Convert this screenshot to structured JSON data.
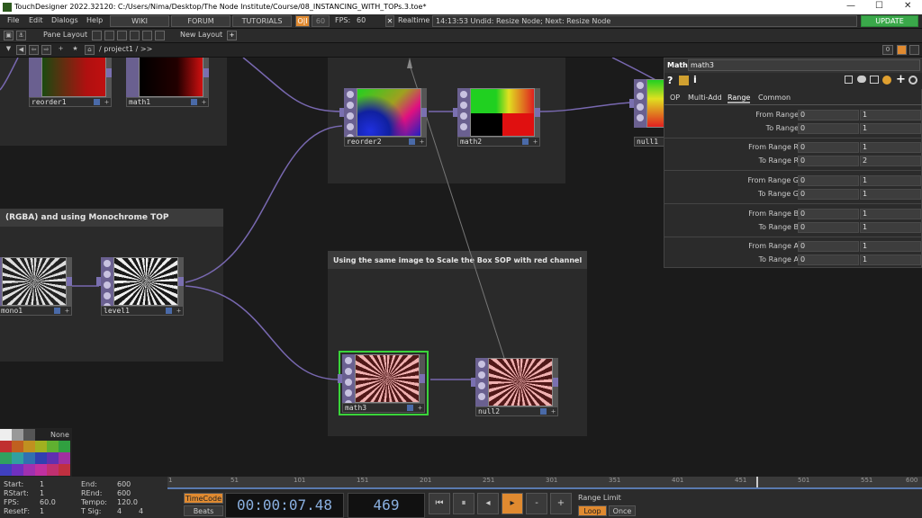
{
  "window": {
    "title": "TouchDesigner 2022.32120: C:/Users/Nima/Desktop/The Node Institute/Course/08_INSTANCING_WITH_TOPs.3.toe*",
    "minimize": "—",
    "maximize": "☐",
    "close": "✕"
  },
  "menu": {
    "items": [
      "File",
      "Edit",
      "Dialogs",
      "Help"
    ],
    "wiki": "WIKI",
    "forum": "FORUM",
    "tutorials": "TUTORIALS",
    "oi": "O|I",
    "fps_target": "60",
    "fps_label": "FPS:",
    "fps_value": "60",
    "realtime": "Realtime",
    "status": "14:13:53 Undid: Resize Node; Next: Resize Node",
    "update": "UPDATE"
  },
  "toolbar": {
    "pane_layout": "Pane Layout",
    "new_layout": "New Layout",
    "plus": "+"
  },
  "pathbar": {
    "path": "/ project1 / >>",
    "counter": "0"
  },
  "network": {
    "titles": {
      "mono": "(RGBA) and using Monochrome TOP",
      "scale": "Using the same image to Scale the Box SOP with red channel"
    },
    "nodes": {
      "reorder1": "reorder1",
      "math1": "math1",
      "reorder2": "reorder2",
      "math2": "math2",
      "null1": "null1",
      "mono1": "mono1",
      "level1": "level1",
      "math3": "math3",
      "null2": "null2"
    },
    "swatch_none": "None"
  },
  "param": {
    "type": "Math",
    "name": "math3",
    "icons": [
      "?",
      "i",
      "+"
    ],
    "tabs": [
      "OP",
      "Multi-Add",
      "Range",
      "Common"
    ],
    "active_tab": "Range",
    "rows": [
      {
        "label": "From Range",
        "v1": "0",
        "v2": "1"
      },
      {
        "label": "To Range",
        "v1": "0",
        "v2": "1"
      },
      {
        "label": "From Range R",
        "v1": "0",
        "v2": "1"
      },
      {
        "label": "To Range R",
        "v1": "0",
        "v2": "2"
      },
      {
        "label": "From Range G",
        "v1": "0",
        "v2": "1"
      },
      {
        "label": "To Range G",
        "v1": "0",
        "v2": "1"
      },
      {
        "label": "From Range B",
        "v1": "0",
        "v2": "1"
      },
      {
        "label": "To Range B",
        "v1": "0",
        "v2": "1"
      },
      {
        "label": "From Range A",
        "v1": "0",
        "v2": "1"
      },
      {
        "label": "To Range A",
        "v1": "0",
        "v2": "1"
      }
    ]
  },
  "timeline": {
    "ticks": [
      "1",
      "51",
      "101",
      "151",
      "201",
      "251",
      "301",
      "351",
      "401",
      "451",
      "501",
      "551",
      "600"
    ]
  },
  "bottom": {
    "start_l": "Start:",
    "start_v": "1",
    "rstart_l": "RStart:",
    "rstart_v": "1",
    "fps_l": "FPS:",
    "fps_v": "60.0",
    "resetf_l": "ResetF:",
    "resetf_v": "1",
    "end_l": "End:",
    "end_v": "600",
    "rend_l": "REnd:",
    "rend_v": "600",
    "tempo_l": "Tempo:",
    "tempo_v": "120.0",
    "tsig_l": "T Sig:",
    "tsig_v1": "4",
    "tsig_v2": "4",
    "timecode": "TimeCode",
    "beats": "Beats",
    "time": "00:00:07.48",
    "frame": "469",
    "range_limit": "Range Limit",
    "loop": "Loop",
    "once": "Once",
    "controls": [
      "⏮",
      "⏸",
      "◂",
      "▸",
      "-",
      "+"
    ]
  },
  "colors": {
    "accent": "#e08a30",
    "selected": "#3ad43a",
    "op": "#6a6090"
  }
}
